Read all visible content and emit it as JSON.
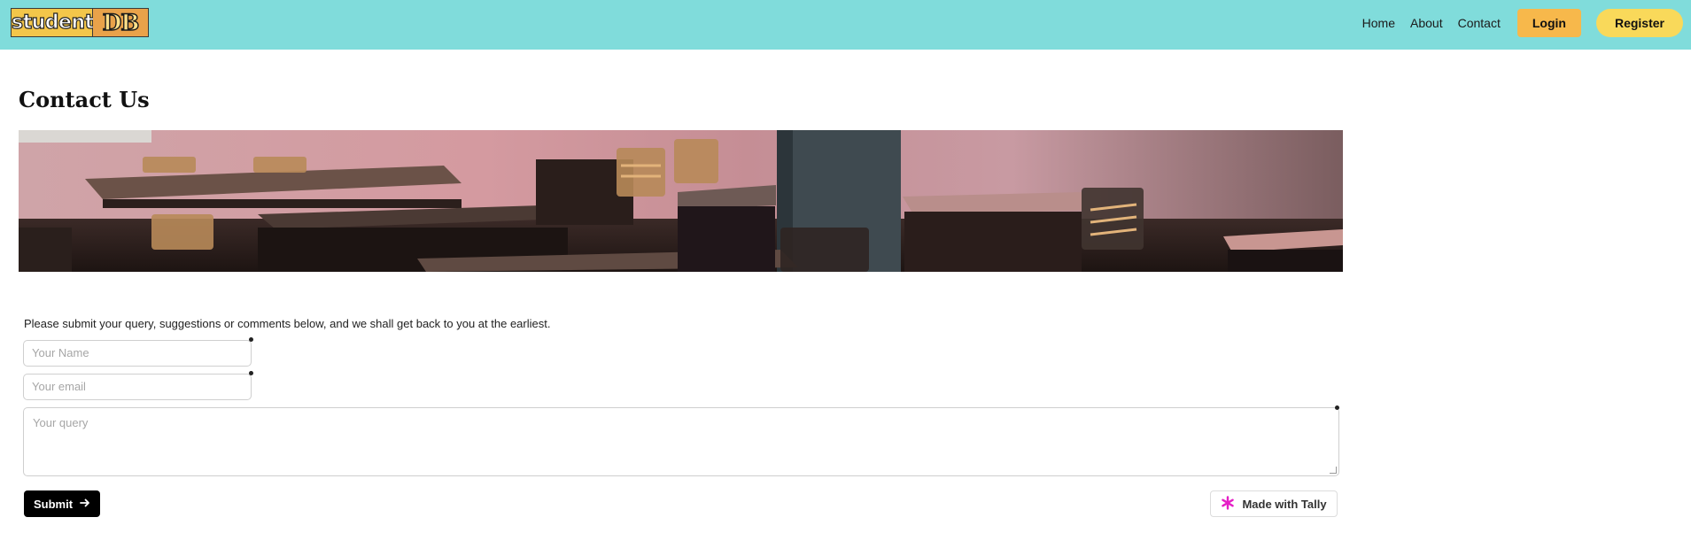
{
  "header": {
    "logo": {
      "part1": "student",
      "part2": "DB"
    },
    "nav": {
      "home": "Home",
      "about": "About",
      "contact": "Contact",
      "login": "Login",
      "register": "Register"
    }
  },
  "page": {
    "title": "Contact Us",
    "banner_icon": "classroom-photo"
  },
  "form": {
    "intro": "Please submit your query, suggestions or comments below, and we shall get back to you at the earliest.",
    "name_placeholder": "Your Name",
    "email_placeholder": "Your email",
    "query_placeholder": "Your query",
    "submit_label": "Submit",
    "submit_icon": "arrow-right-icon",
    "tally_label": "Made with Tally",
    "tally_icon": "tally-asterisk-icon"
  },
  "colors": {
    "header_bg": "#80dcdb",
    "login_bg": "#f7b84b",
    "register_bg": "#f9d95a",
    "submit_bg": "#000000",
    "tally_accent": "#e51fc6"
  }
}
